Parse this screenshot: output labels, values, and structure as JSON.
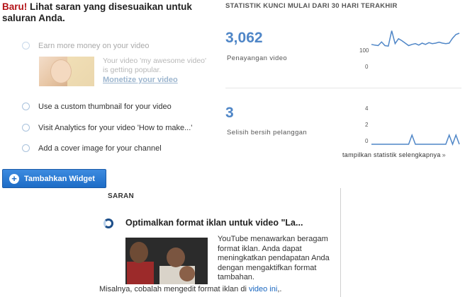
{
  "headline": {
    "new_tag": "Baru!",
    "text": " Lihat saran yang disesuaikan untuk saluran Anda."
  },
  "suggestions": [
    {
      "label": "Earn more money on your video",
      "faded": true
    },
    {
      "label": "Use a custom thumbnail for your video",
      "faded": false
    },
    {
      "label": "Visit Analytics for your video  'How to make...'",
      "faded": false
    },
    {
      "label": "Add a cover image for your channel",
      "faded": false
    }
  ],
  "promo": {
    "text": "Your video 'my awesome video' is getting popular.",
    "link": "Monetize your video"
  },
  "add_widget_button": "Tambahkan Widget",
  "stats": {
    "title": "STATISTIK KUNCI MULAI DARI 30 HARI TERAKHIR",
    "views": {
      "value": "3,062",
      "label": "Penayangan video",
      "axis_top": "100",
      "axis_bottom": "0",
      "series": [
        95,
        92,
        90,
        105,
        90,
        88,
        150,
        98,
        118,
        110,
        100,
        90,
        95,
        98,
        92,
        100,
        95,
        102,
        98,
        100,
        104,
        100,
        98,
        100,
        120,
        135,
        140
      ]
    },
    "subscribers": {
      "value": "3",
      "label": "Selisih bersih pelanggan",
      "axis_top": "4",
      "axis_mid": "2",
      "axis_bottom": "0",
      "series": [
        0,
        0,
        0,
        0,
        0,
        0,
        0,
        0,
        0,
        0,
        0,
        0,
        1,
        0,
        0,
        0,
        0,
        0,
        0,
        0,
        0,
        0,
        0,
        1,
        0,
        1,
        0
      ]
    },
    "more_link": "tampilkan statistik selengkapnya",
    "more_arrow": "»",
    "color": "#4f86c7"
  },
  "panel": {
    "title": "SARAN",
    "heading": "Optimalkan format iklan untuk video \"La...",
    "body": "YouTube menawarkan beragam format iklan. Anda dapat meningkatkan pendapatan Anda dengan mengaktifkan format tambahan.",
    "body2_prefix": "Misalnya, cobalah mengedit format iklan di ",
    "body2_link": "video ini",
    "body2_suffix": ",."
  }
}
